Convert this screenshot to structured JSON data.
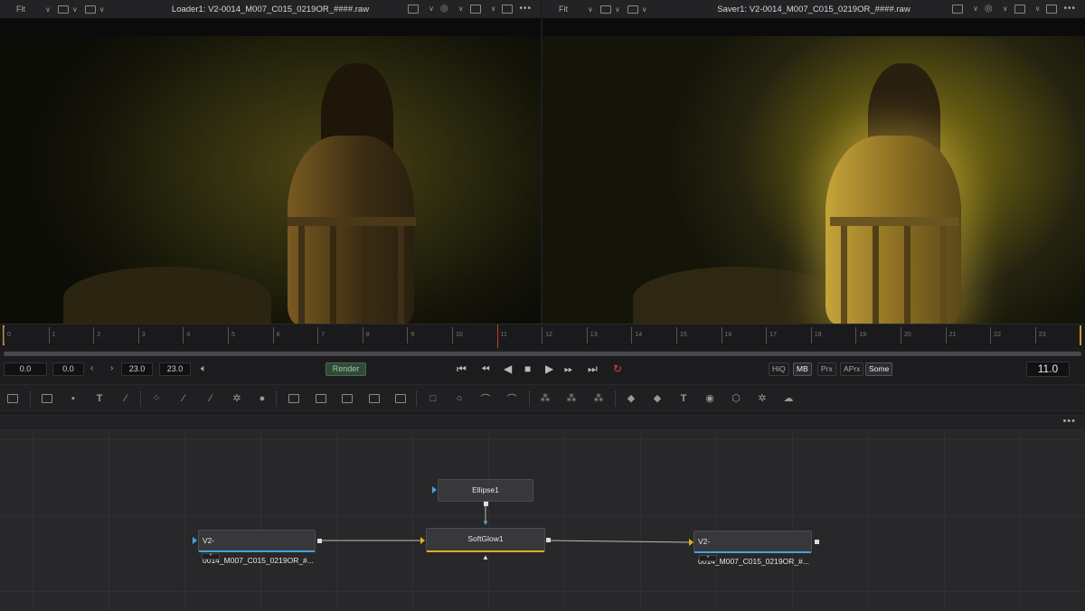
{
  "viewer_left": {
    "fit_label": "Fit",
    "title": "Loader1: V2-0014_M007_C015_0219OR_####.raw",
    "more_label": "•••"
  },
  "viewer_right": {
    "fit_label": "Fit",
    "title": "Saver1: V2-0014_M007_C015_0219OR_####.raw",
    "more_label": "•••"
  },
  "ruler": {
    "ticks": [
      "0",
      "1",
      "2",
      "3",
      "4",
      "5",
      "6",
      "7",
      "8",
      "9",
      "10",
      "11",
      "12",
      "13",
      "14",
      "15",
      "16",
      "17",
      "18",
      "19",
      "20",
      "21",
      "22",
      "23"
    ],
    "current_frame": 11.0
  },
  "transport": {
    "global_start": "0.0",
    "render_start": "0.0",
    "render_end": "23.0",
    "global_end": "23.0",
    "render_label": "Render",
    "hiq_label": "HiQ",
    "mb_label": "MB",
    "prx_label": "Prx",
    "aprx_label": "APrx",
    "some_label": "Some",
    "current_time": "11.0"
  },
  "nodes": {
    "ellipse": "Ellipse1",
    "softglow": "SoftGlow1",
    "loader": "V2-0014_M007_C015_0219OR_#...",
    "saver": "V2-0014_M007_C015_0219OR_#..."
  },
  "node_header": {
    "more_label": "•••"
  },
  "colors": {
    "loader_accent": "#4aa0e0",
    "effect_accent": "#e0b020",
    "playhead": "#c0402a",
    "render_button": "#2f4a36"
  }
}
